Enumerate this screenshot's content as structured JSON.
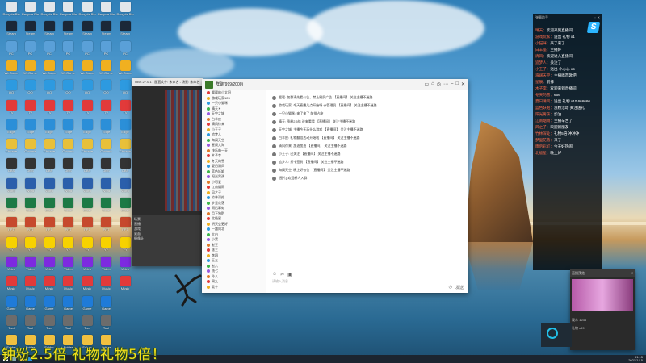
{
  "desktop": {
    "icons": [
      {
        "caption": "Recycle Bin",
        "color": "#e2e6ea"
      },
      {
        "caption": "Steam",
        "color": "#1b2838"
      },
      {
        "caption": "PC",
        "color": "#5aa0d8"
      },
      {
        "caption": "WeGame",
        "color": "#f0b020"
      },
      {
        "caption": "QQ",
        "color": "#2d9ae0"
      },
      {
        "caption": "TV",
        "color": "#e23a3a"
      },
      {
        "caption": "Edge",
        "color": "#2b8fd8"
      },
      {
        "caption": "Chrome",
        "color": "#e8c03a"
      },
      {
        "caption": "OBS",
        "color": "#333"
      },
      {
        "caption": "Word",
        "color": "#2b5fab"
      },
      {
        "caption": "Excel",
        "color": "#1d7a45"
      },
      {
        "caption": "PPT",
        "color": "#c6492d"
      },
      {
        "caption": "YY",
        "color": "#f7d200"
      },
      {
        "caption": "Video",
        "color": "#7d2ae0"
      },
      {
        "caption": "Music",
        "color": "#e23a3a"
      },
      {
        "caption": "Game",
        "color": "#1f7bd8"
      },
      {
        "caption": "Tool",
        "color": "#6c6c6c"
      },
      {
        "caption": "Folder",
        "color": "#f0c040"
      }
    ]
  },
  "obs": {
    "title": "OBS 27.0.1 - 配置文件: 未命名 - 场景: 未命名",
    "scenes": [
      "场景",
      "直播",
      "游戏",
      "桌面",
      "摄像头"
    ]
  },
  "chat": {
    "title": "群聊(999/2000)",
    "members": [
      "暖暖的小太阳",
      "游戏玩家123",
      "一只小猫咪",
      "晴天☀",
      "天空之城",
      "白羊座",
      "清风徐来",
      "小王子",
      "追梦人",
      "海阔天空",
      "星辰大海",
      "快乐每一天",
      "木子李",
      "冬天的雪",
      "夏日清风",
      "蓝色妖姬",
      "阳光男孩",
      "小可爱",
      "江南烟雨",
      "风之子",
      "竹林深处",
      "梦里花落",
      "雨后彩虹",
      "月下独酌",
      "北极星",
      "明天会更好",
      "一路向北",
      "大白",
      "小黑",
      "老王",
      "张三",
      "李四",
      "王五",
      "赵六",
      "钱七",
      "孙八",
      "周九",
      "吴十"
    ],
    "messages": [
      "暖暖: 加群请先看公告，禁止刷屏广告 【直播间】 关注主播不迷路",
      "游戏玩家: 今天直播几点开始呀 @管理员 【直播间】 关注主播不迷路",
      "一只小猫咪: 来了来了 前排占座",
      "晴天: 涨粉2.5倍 进来看看 【直播间】 关注主播不迷路",
      "天空之城: 主播今天玩什么游戏 【直播间】 关注主播不迷路",
      "白羊座: 礼物翻倍活动开始啦 【直播间】 关注主播不迷路",
      "清风徐来: 加油加油 【直播间】 关注主播不迷路",
      "小王子: 已关注 【直播间】 关注主播不迷路",
      "追梦人: 打卡签到 【直播间】 关注主播不迷路",
      "海阔天空: 晚上好各位 【直播间】 关注主播不迷路",
      "[图片] 欢迎新人入群"
    ],
    "input_placeholder": "请输入消息...",
    "send_label": "发送"
  },
  "danmaku": {
    "header": "弹幕助手",
    "lines": [
      {
        "nick": "晴天：",
        "text": "欢迎来到直播间"
      },
      {
        "nick": "游戏玩家：",
        "text": "送出 礼物 x1"
      },
      {
        "nick": "小猫咪：",
        "text": "来了来了"
      },
      {
        "nick": "白羊座：",
        "text": "主播好"
      },
      {
        "nick": "清风：",
        "text": "欢迎进入直播间"
      },
      {
        "nick": "追梦人：",
        "text": "关注了"
      },
      {
        "nick": "小王子：",
        "text": "送出 小心心 x5"
      },
      {
        "nick": "海阔天空：",
        "text": "主播唱首歌吧"
      },
      {
        "nick": "星辰：",
        "text": "前排"
      },
      {
        "nick": "木子李：",
        "text": "欢迎来到直播间"
      },
      {
        "nick": "冬天的雪：",
        "text": "666"
      },
      {
        "nick": "夏日清风：",
        "text": "送出 礼物 x10 666666"
      },
      {
        "nick": "蓝色妖姬：",
        "text": "涨粉活动 关注送礼"
      },
      {
        "nick": "阳光男孩：",
        "text": "加油"
      },
      {
        "nick": "江南烟雨：",
        "text": "主播辛苦了"
      },
      {
        "nick": "风之子：",
        "text": "欢迎新朋友"
      },
      {
        "nick": "竹林深处：",
        "text": "礼物5倍 冲冲冲"
      },
      {
        "nick": "梦里花落：",
        "text": "来了"
      },
      {
        "nick": "雨后彩虹：",
        "text": "今天好热闹"
      },
      {
        "nick": "北极星：",
        "text": "晚上好"
      }
    ]
  },
  "popup": {
    "title": "直播预览",
    "row1": "观众 1234",
    "row2": "礼物 x99"
  },
  "taskbar": {
    "time": "21:15",
    "date": "2021/1/15"
  },
  "banner": {
    "text": "钟粉2.5倍 礼物礼物5倍！"
  }
}
